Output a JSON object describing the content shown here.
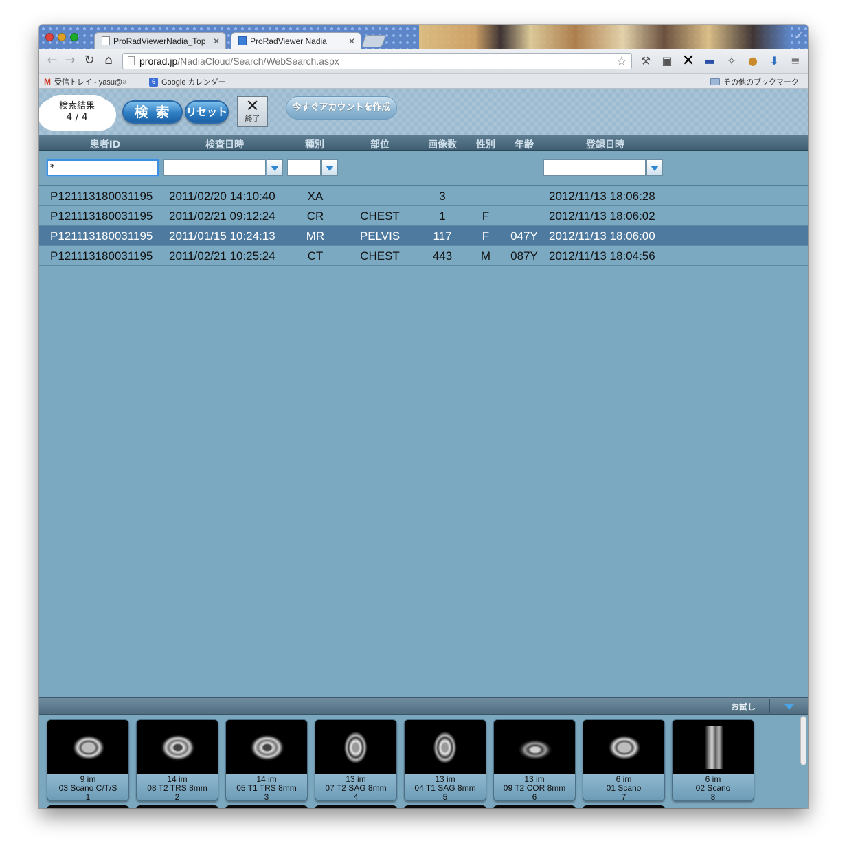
{
  "browser": {
    "tabs": [
      {
        "title": "ProRadViewerNadia_Top",
        "active": false
      },
      {
        "title": "ProRadViewer Nadia",
        "active": true
      }
    ],
    "url_host": "prorad.jp",
    "url_path": "/NadiaCloud/Search/WebSearch.aspx",
    "bookmarks": {
      "gmail": "受信トレイ - yasu@",
      "gmail_fade": "a",
      "calendar_icon": "6",
      "calendar": "Google カレンダー",
      "other": "その他のブックマーク"
    },
    "extension_icons": [
      "wrench-icon",
      "tag-icon",
      "x-icon",
      "flag-icon",
      "puzzle-icon",
      "cookie-icon",
      "download-icon",
      "menu-icon"
    ]
  },
  "header": {
    "result_label": "検索結果",
    "result_count": "4 / 4",
    "search_label": "検 索",
    "reset_label": "リセット",
    "exit_label": "終了",
    "create_account_label": "今すぐアカウントを作成"
  },
  "grid": {
    "columns": [
      "患者ID",
      "検査日時",
      "種別",
      "部位",
      "画像数",
      "性別",
      "年齢",
      "登録日時"
    ],
    "filter_patient_id": "*",
    "rows": [
      {
        "patient_id": "P121113180031195",
        "study_date": "2011/02/20 14:10:40",
        "modality": "XA",
        "body_part": "",
        "images": "3",
        "sex": "",
        "age": "",
        "registered": "2012/11/13 18:06:28",
        "selected": false
      },
      {
        "patient_id": "P121113180031195",
        "study_date": "2011/02/21 09:12:24",
        "modality": "CR",
        "body_part": "CHEST",
        "images": "1",
        "sex": "F",
        "age": "",
        "registered": "2012/11/13 18:06:02",
        "selected": false
      },
      {
        "patient_id": "P121113180031195",
        "study_date": "2011/01/15 10:24:13",
        "modality": "MR",
        "body_part": "PELVIS",
        "images": "117",
        "sex": "F",
        "age": "047Y",
        "registered": "2012/11/13 18:06:00",
        "selected": true
      },
      {
        "patient_id": "P121113180031195",
        "study_date": "2011/02/21 10:25:24",
        "modality": "CT",
        "body_part": "CHEST",
        "images": "443",
        "sex": "M",
        "age": "087Y",
        "registered": "2012/11/13 18:04:56",
        "selected": false
      }
    ]
  },
  "panel": {
    "trial_label": "お試し"
  },
  "series": [
    {
      "count": "9 im",
      "name": "03 Scano C/T/S",
      "index": "1",
      "kind": "axial"
    },
    {
      "count": "14 im",
      "name": "08 T2 TRS 8mm",
      "index": "2",
      "kind": "axial2"
    },
    {
      "count": "14 im",
      "name": "05 T1 TRS 8mm",
      "index": "3",
      "kind": "axial2"
    },
    {
      "count": "13 im",
      "name": "07 T2 SAG 8mm",
      "index": "4",
      "kind": "sag"
    },
    {
      "count": "13 im",
      "name": "04 T1 SAG 8mm",
      "index": "5",
      "kind": "sag"
    },
    {
      "count": "13 im",
      "name": "09 T2 COR 8mm",
      "index": "6",
      "kind": "cor"
    },
    {
      "count": "6 im",
      "name": "01 Scano",
      "index": "7",
      "kind": "axial"
    },
    {
      "count": "6 im",
      "name": "02 Scano",
      "index": "8",
      "kind": "spine"
    }
  ]
}
